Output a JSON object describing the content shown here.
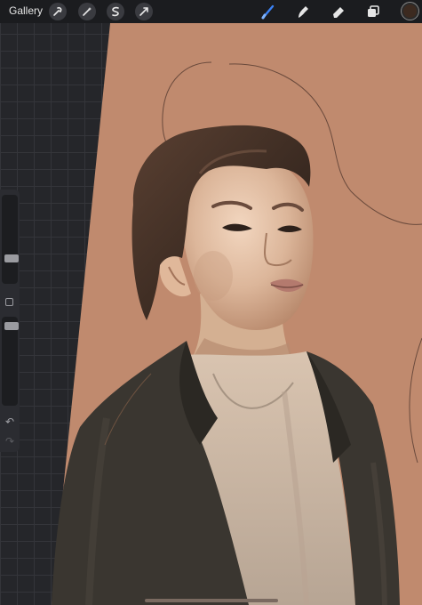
{
  "app": {
    "gallery_label": "Gallery"
  },
  "toolbar": {
    "left_tools": [
      "wrench-icon",
      "magic-wand-icon",
      "selection-icon",
      "transform-icon"
    ],
    "right_tools": [
      "brush-icon",
      "smudge-icon",
      "eraser-icon",
      "layers-icon"
    ],
    "active_tool": "brush-icon",
    "active_color": "#3c2a20",
    "accent": "#3b82f6"
  },
  "sidebar": {
    "brush_size_level": 0.25,
    "brush_opacity_level": 0.95,
    "icons": [
      "modify-button",
      "undo-icon",
      "redo-icon"
    ]
  },
  "canvas": {
    "background_color": "#c08a6e"
  }
}
